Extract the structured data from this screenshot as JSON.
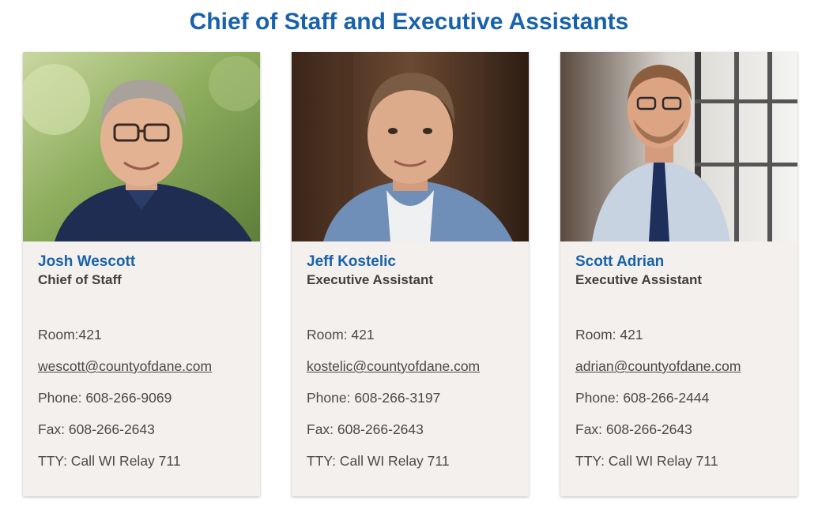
{
  "page": {
    "title": "Chief of Staff and Executive Assistants"
  },
  "staff": [
    {
      "name": "Josh Wescott",
      "role": "Chief of Staff",
      "room": "Room:421",
      "email": "wescott@countyofdane.com",
      "phone": "Phone: 608-266-9069",
      "fax": "Fax: 608-266-2643",
      "tty": "TTY: Call WI Relay 711"
    },
    {
      "name": "Jeff Kostelic",
      "role": "Executive Assistant",
      "room": "Room: 421",
      "email": "kostelic@countyofdane.com",
      "phone": "Phone: 608-266-3197",
      "fax": "Fax: 608-266-2643",
      "tty": "TTY: Call WI Relay 711"
    },
    {
      "name": "Scott Adrian",
      "role": "Executive Assistant",
      "room": "Room: 421",
      "email": "adrian@countyofdane.com",
      "phone": "Phone: 608-266-2444",
      "fax": "Fax: 608-266-2643",
      "tty": "TTY: Call WI Relay 711"
    }
  ],
  "colors": {
    "heading_blue": "#1862ab",
    "card_background": "#f3f0ed",
    "body_text": "#4a4a4a"
  }
}
